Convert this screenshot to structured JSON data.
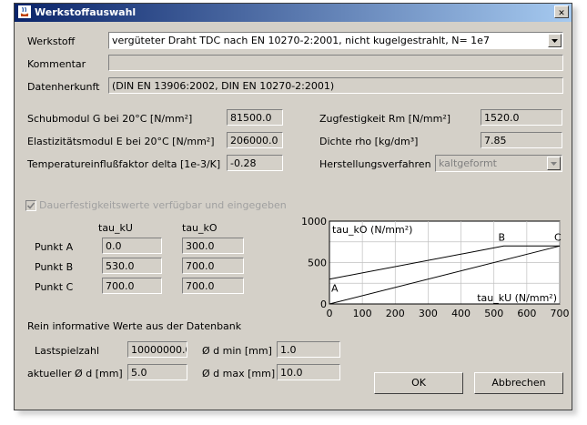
{
  "window": {
    "title": "Werkstoffauswahl",
    "close_glyph": "✕"
  },
  "werkstoff": {
    "label": "Werkstoff",
    "value": "vergüteter Draht TDC nach EN 10270-2:2001, nicht kugelgestrahlt, N= 1e7"
  },
  "kommentar": {
    "label": "Kommentar",
    "value": ""
  },
  "datenherkunft": {
    "label": "Datenherkunft",
    "value": "(DIN EN 13906:2002, DIN EN 10270-2:2001)"
  },
  "props": {
    "schubmodul": {
      "label": "Schubmodul G bei 20°C [N/mm²]",
      "value": "81500.0"
    },
    "elastizitaet": {
      "label": "Elastizitätsmodul E bei 20°C [N/mm²]",
      "value": "206000.0"
    },
    "tempfaktor": {
      "label": "Temperatureinflußfaktor delta [1e-3/K]",
      "value": "-0.28"
    },
    "zugfestigkeit": {
      "label": "Zugfestigkeit Rm [N/mm²]",
      "value": "1520.0"
    },
    "dichte": {
      "label": "Dichte rho [kg/dm³]",
      "value": "7.85"
    },
    "herstellung": {
      "label": "Herstellungsverfahren",
      "value": "kaltgeformt"
    }
  },
  "dauer": {
    "checkbox_label": "Dauerfestigkeitswerte verfügbar und eingegeben",
    "checked": true,
    "col_ku": "tau_kU",
    "col_ko": "tau_kO",
    "rows": [
      {
        "label": "Punkt A",
        "ku": "0.0",
        "ko": "300.0"
      },
      {
        "label": "Punkt B",
        "ku": "530.0",
        "ko": "700.0"
      },
      {
        "label": "Punkt C",
        "ku": "700.0",
        "ko": "700.0"
      }
    ]
  },
  "info": {
    "heading": "Rein informative Werte aus der Datenbank",
    "lastspiel": {
      "label": "Lastspielzahl",
      "value": "10000000.0"
    },
    "dmin": {
      "label": "Ø d min [mm]",
      "value": "1.0"
    },
    "aktuell": {
      "label": "aktueller Ø d [mm]",
      "value": "5.0"
    },
    "dmax": {
      "label": "Ø d max [mm]",
      "value": "10.0"
    }
  },
  "buttons": {
    "ok": "OK",
    "cancel": "Abbrechen"
  },
  "chart_data": {
    "type": "line",
    "ylabel": "tau_kO (N/mm²)",
    "xlabel": "tau_kU (N/mm²)",
    "xlim": [
      0,
      700
    ],
    "ylim": [
      0,
      1000
    ],
    "x_ticks": [
      0,
      100,
      200,
      300,
      400,
      500,
      600,
      700
    ],
    "y_ticks": [
      0,
      500,
      1000
    ],
    "series": [
      {
        "x": [
          0,
          530,
          700
        ],
        "y": [
          300,
          700,
          700
        ]
      },
      {
        "x": [
          0,
          700
        ],
        "y": [
          0,
          700
        ]
      }
    ],
    "point_labels": [
      {
        "text": "A",
        "x": 0,
        "y": 300
      },
      {
        "text": "B",
        "x": 530,
        "y": 700
      },
      {
        "text": "C",
        "x": 700,
        "y": 700
      }
    ],
    "grid": true
  }
}
